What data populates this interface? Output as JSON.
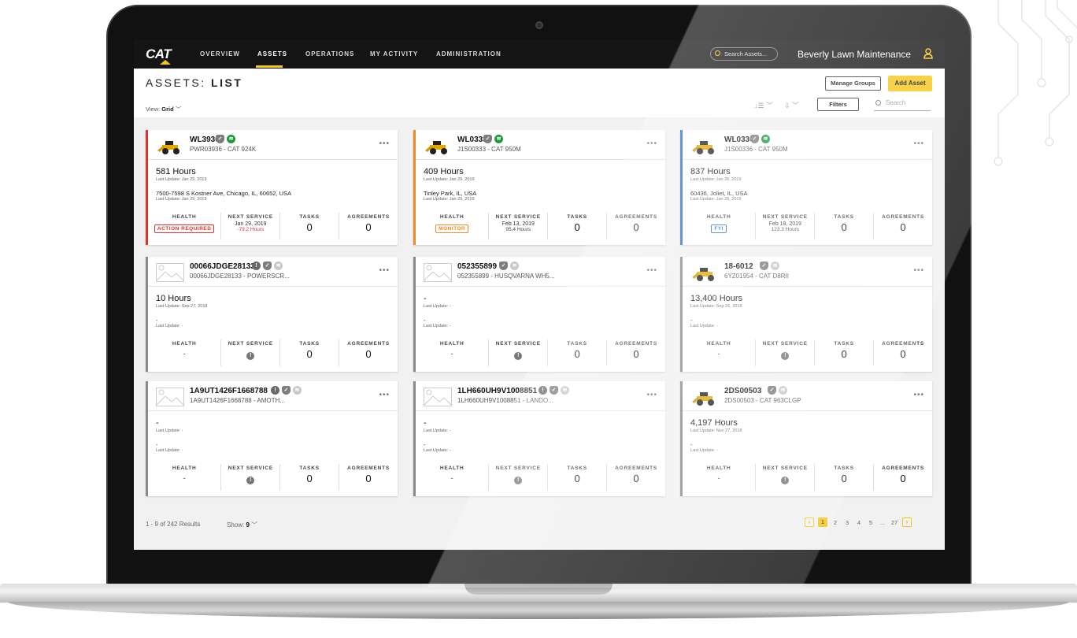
{
  "nav": {
    "logo": "CAT",
    "items": [
      {
        "label": "OVERVIEW"
      },
      {
        "label": "ASSETS"
      },
      {
        "label": "OPERATIONS"
      },
      {
        "label": "MY ACTIVITY"
      },
      {
        "label": "ADMINISTRATION"
      }
    ],
    "search_placeholder": "Search Assets...",
    "account": "Beverly Lawn Maintenance"
  },
  "header": {
    "title_prefix": "ASSETS: ",
    "title_bold": "LIST",
    "view_label": "View: ",
    "view_value": "Grid",
    "manage_groups": "Manage Groups",
    "add_asset": "Add Asset",
    "filters": "Filters",
    "search_placeholder": "Search"
  },
  "stat_labels": {
    "health": "HEALTH",
    "next_service": "NEXT SERVICE",
    "tasks": "TASKS",
    "agreements": "AGREEMENTS"
  },
  "cards": [
    {
      "title": "WL3936",
      "subtitle": "PWR03936 - CAT 924K",
      "hours": "581 Hours",
      "hours_update": "Last Update: Jan 29, 2019",
      "location": "7500-7598 S Kostner Ave, Chicago, IL, 60652, USA",
      "location_update": "Last Update: Jan 29, 2019",
      "health": "ACTION REQUIRED",
      "next_service_date": "Jan 29, 2019",
      "next_service_hours": "-79.2 Hours",
      "tasks": "0",
      "agreements": "0",
      "accent": "#e0312b"
    },
    {
      "title": "WL0333",
      "subtitle": "J1S00333 - CAT 950M",
      "hours": "409 Hours",
      "hours_update": "Last Update: Jan 29, 2019",
      "location": "Tinley Park, IL, USA",
      "location_update": "Last Update: Jan 29, 2019",
      "health": "MONITOR",
      "next_service_date": "Feb 13, 2019",
      "next_service_hours": "95.4 Hours",
      "tasks": "0",
      "agreements": "0",
      "accent": "#f08a24"
    },
    {
      "title": "WL0336",
      "subtitle": "J1S00336 - CAT 950M",
      "hours": "837 Hours",
      "hours_update": "Last Update: Jan 28, 2019",
      "location": "60436, Joliet, IL, USA",
      "location_update": "Last Update: Jan 28, 2019",
      "health": "FYI",
      "next_service_date": "Feb 19, 2019",
      "next_service_hours": "123.3 Hours",
      "tasks": "0",
      "agreements": "0",
      "accent": "#2f6fc4"
    },
    {
      "title": "00066JDGE28133",
      "subtitle": "00066JDGE28133 - POWERSCR...",
      "hours": "10 Hours",
      "hours_update": "Last Update: Sep 27, 2018",
      "location": "-",
      "location_update": "Last Update: -",
      "health": "-",
      "tasks": "0",
      "agreements": "0",
      "accent": "#8a8a8a"
    },
    {
      "title": "052355899",
      "subtitle": "052355899 - HUSQVARNA WH5...",
      "hours": "-",
      "hours_update": "Last Update: -",
      "location": "-",
      "location_update": "Last Update: -",
      "health": "-",
      "tasks": "0",
      "agreements": "0",
      "accent": "#8a8a8a"
    },
    {
      "title": "18-6012",
      "subtitle": "6YZ01954 - CAT D8RII",
      "hours": "13,400 Hours",
      "hours_update": "Last Update: Sep 26, 2018",
      "location": "-",
      "location_update": "Last Update: -",
      "health": "-",
      "tasks": "0",
      "agreements": "0",
      "accent": "#8a8a8a"
    },
    {
      "title": "1A9UT1426F1668788",
      "subtitle": "1A9UT1426F1668788 - AMOTH...",
      "hours": "-",
      "hours_update": "Last Update: -",
      "location": "-",
      "location_update": "Last Update: -",
      "health": "-",
      "tasks": "0",
      "agreements": "0",
      "accent": "#8a8a8a"
    },
    {
      "title": "1LH660UH9V1008851",
      "subtitle": "1LH660UH9V1008851 - LANDO...",
      "hours": "-",
      "hours_update": "Last Update: -",
      "location": "-",
      "location_update": "Last Update: -",
      "health": "-",
      "tasks": "0",
      "agreements": "0",
      "accent": "#8a8a8a"
    },
    {
      "title": "2DS00503",
      "subtitle": "2DS00503 - CAT 963CLGP",
      "hours": "4,197 Hours",
      "hours_update": "Last Update: Nov 27, 2018",
      "location": "-",
      "location_update": "Last Update: -",
      "health": "-",
      "tasks": "0",
      "agreements": "0",
      "accent": "#8a8a8a"
    }
  ],
  "footer": {
    "results": "1 - 9 of 242 Results",
    "show_label": "Show: ",
    "show_value": "9",
    "pages": [
      "1",
      "2",
      "3",
      "4",
      "5",
      "...",
      "27"
    ]
  },
  "colors": {
    "brand_yellow": "#f5c518",
    "navbar": "#141414",
    "action_required": "#e0312b",
    "monitor": "#f08a24",
    "fyi": "#2f6fc4"
  }
}
